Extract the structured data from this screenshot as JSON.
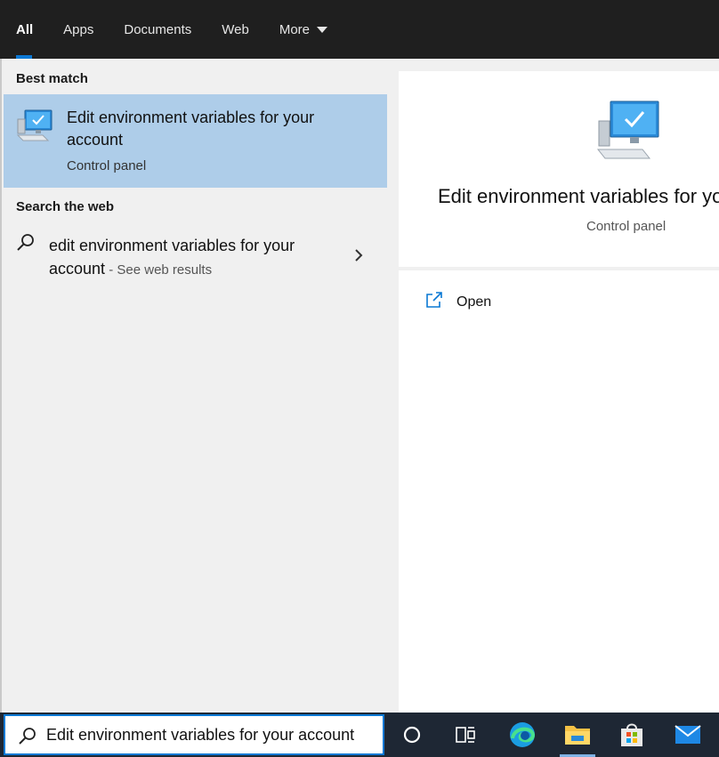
{
  "tabs": [
    {
      "label": "All",
      "active": true
    },
    {
      "label": "Apps"
    },
    {
      "label": "Documents"
    },
    {
      "label": "Web"
    },
    {
      "label": "More",
      "has_dropdown": true
    }
  ],
  "best_match": {
    "header": "Best match",
    "title": "Edit environment variables for your account",
    "subtitle": "Control panel",
    "icon": "computer-monitor-icon",
    "highlight_color": "#aecde9"
  },
  "search_web": {
    "header": "Search the web",
    "query": "edit environment variables for your account",
    "suffix": " - See web results",
    "icon": "search-icon"
  },
  "preview": {
    "title": "Edit environment variables for your account",
    "subtitle": "Control panel",
    "actions": [
      {
        "label": "Open",
        "icon": "open-external-icon"
      }
    ]
  },
  "taskbar": {
    "search_value": "Edit environment variables for your account",
    "items": [
      "cortana-icon",
      "task-view-icon",
      "edge-icon",
      "file-explorer-icon",
      "store-icon",
      "mail-icon"
    ],
    "accent_color": "#0a78d4"
  }
}
